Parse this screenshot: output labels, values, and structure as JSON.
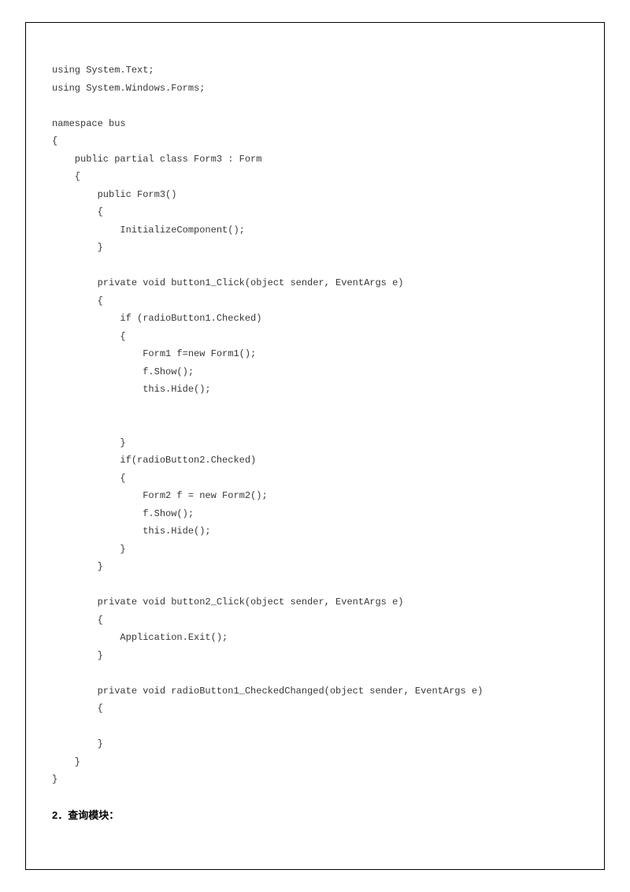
{
  "code": "using System.Text;\nusing System.Windows.Forms;\n\nnamespace bus\n{\n    public partial class Form3 : Form\n    {\n        public Form3()\n        {\n            InitializeComponent();\n        }\n\n        private void button1_Click(object sender, EventArgs e)\n        {\n            if (radioButton1.Checked)\n            {\n                Form1 f=new Form1();\n                f.Show();\n                this.Hide();\n\n\n            }\n            if(radioButton2.Checked)\n            {\n                Form2 f = new Form2();\n                f.Show();\n                this.Hide();\n            }\n        }\n\n        private void button2_Click(object sender, EventArgs e)\n        {\n            Application.Exit();\n        }\n\n        private void radioButton1_CheckedChanged(object sender, EventArgs e)\n        {\n\n        }\n    }\n}",
  "heading": "2．查询模块："
}
